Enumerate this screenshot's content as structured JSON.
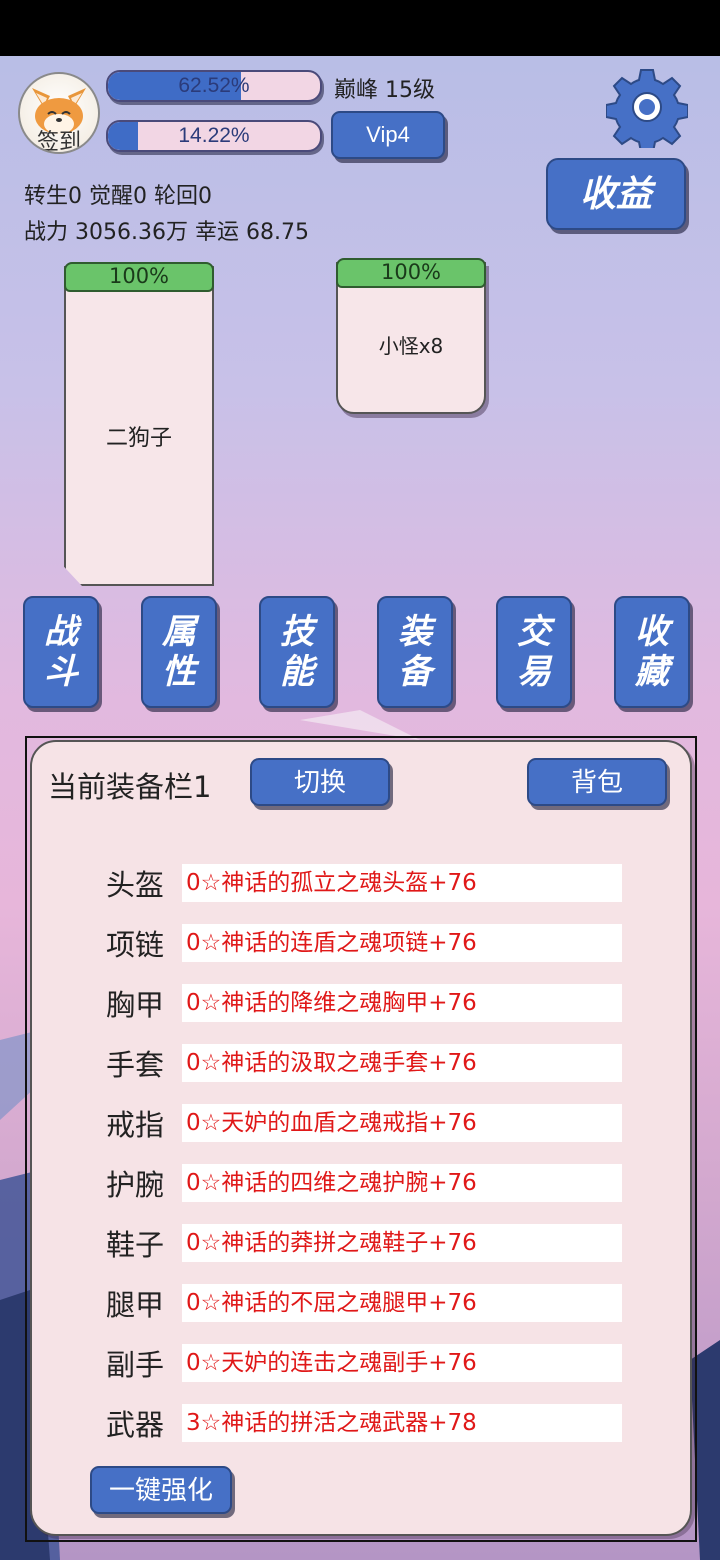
{
  "header": {
    "signin_label": "签到",
    "exp_percent_text": "62.52%",
    "exp_fraction": 0.6252,
    "level_text": "巅峰 15级",
    "second_percent_text": "14.22%",
    "second_fraction": 0.1422,
    "vip_label": "Vip4",
    "earnings_label": "收益"
  },
  "stats": {
    "line1": "转生0 觉醒0 轮回0",
    "line2": "战力 3056.36万  幸运 68.75"
  },
  "battle": {
    "player": {
      "hp_text": "100%",
      "name": "二狗子"
    },
    "enemy": {
      "hp_text": "100%",
      "name": "小怪x8"
    }
  },
  "menu": [
    {
      "line1": "战",
      "line2": "斗"
    },
    {
      "line1": "属",
      "line2": "性"
    },
    {
      "line1": "技",
      "line2": "能"
    },
    {
      "line1": "装",
      "line2": "备"
    },
    {
      "line1": "交",
      "line2": "易"
    },
    {
      "line1": "收",
      "line2": "藏"
    }
  ],
  "equipment": {
    "title": "当前装备栏1",
    "switch_label": "切换",
    "bag_label": "背包",
    "slots": [
      {
        "label": "头盔",
        "value": "0☆神话的孤立之魂头盔+76"
      },
      {
        "label": "项链",
        "value": "0☆神话的连盾之魂项链+76"
      },
      {
        "label": "胸甲",
        "value": "0☆神话的降维之魂胸甲+76"
      },
      {
        "label": "手套",
        "value": "0☆神话的汲取之魂手套+76"
      },
      {
        "label": "戒指",
        "value": "0☆天妒的血盾之魂戒指+76"
      },
      {
        "label": "护腕",
        "value": "0☆神话的四维之魂护腕+76"
      },
      {
        "label": "鞋子",
        "value": "0☆神话的莽拼之魂鞋子+76"
      },
      {
        "label": "腿甲",
        "value": "0☆神话的不屈之魂腿甲+76"
      },
      {
        "label": "副手",
        "value": "0☆天妒的连击之魂副手+76"
      },
      {
        "label": "武器",
        "value": "3☆神话的拼活之魂武器+78"
      }
    ],
    "upgrade_all_label": "一键强化"
  },
  "colors": {
    "button_blue": "#4670c6",
    "hp_green": "#6ac46a",
    "equip_text_red": "#e01818"
  }
}
